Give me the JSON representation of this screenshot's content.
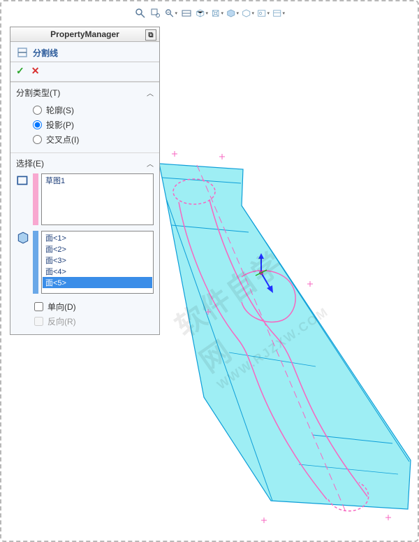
{
  "panel_title": "PropertyManager",
  "feature_name": "分割线",
  "sections": {
    "split_type": {
      "title": "分割类型(T)",
      "options": {
        "silhouette": "轮廓(S)",
        "projection": "投影(P)",
        "intersection": "交叉点(I)"
      },
      "selected": "projection"
    },
    "selection": {
      "title": "选择(E)",
      "sketch_items": [
        "草图1"
      ],
      "face_items": [
        "面<1>",
        "面<2>",
        "面<3>",
        "面<4>",
        "面<5>"
      ],
      "face_selected_index": 4,
      "checkboxes": {
        "single_direction": "单向(D)",
        "reverse": "反向(R)"
      }
    }
  },
  "watermark_lines": [
    "软件自学网",
    "WWW.RJZXW.COM"
  ],
  "colors": {
    "surface": "#7de8f0",
    "surface_edge": "#0d9ed8",
    "sketch": "#f766c0",
    "select_hilite": "#3a8de8"
  }
}
